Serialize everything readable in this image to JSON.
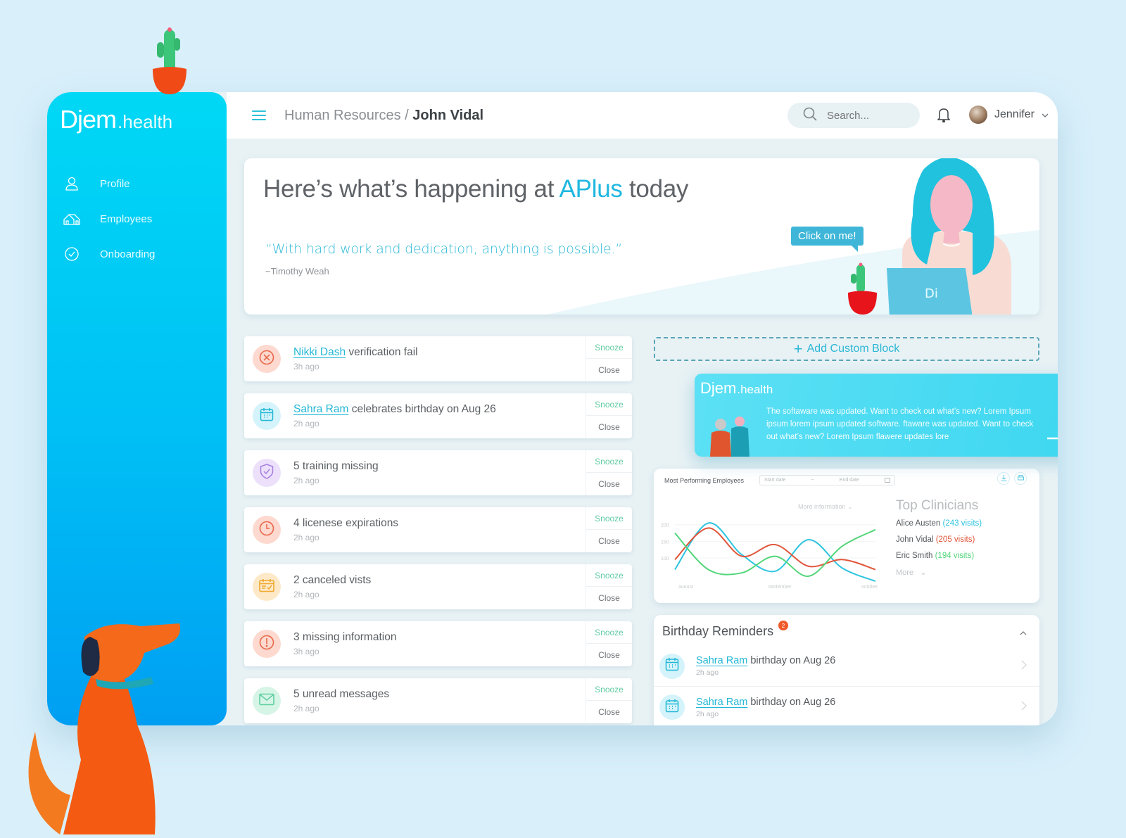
{
  "brand": {
    "name_main": "Djem",
    "name_suffix": ".health",
    "accent": "#1fb8e0",
    "sidebar_gradient": [
      "#00d8f5",
      "#009ef2"
    ]
  },
  "sidebar": {
    "items": [
      {
        "label": "Profile",
        "icon": "user-icon"
      },
      {
        "label": "Employees",
        "icon": "house-icon"
      },
      {
        "label": "Onboarding",
        "icon": "check-circle-icon"
      }
    ]
  },
  "topbar": {
    "breadcrumb_parent": "Human Resources",
    "breadcrumb_separator": " / ",
    "breadcrumb_current": "John Vidal",
    "search_placeholder": "Search...",
    "user_name": "Jennifer"
  },
  "hero": {
    "title_pre": "Here’s what’s happening at ",
    "title_accent": "APlus",
    "title_post": " today",
    "quote": "“With hard work and dedication, anything is possible.”",
    "quote_author": "~Timothy Weah",
    "bubble_label": "Click on me!"
  },
  "notifications": [
    {
      "link": "Nikki Dash",
      "text": " verification fail",
      "time": "3h ago",
      "icon": "x-circle-icon",
      "color": "#e8694a",
      "bg": "#fdd9cf"
    },
    {
      "link": "Sahra Ram",
      "text": " celebrates birthday on Aug 26",
      "time": "2h ago",
      "icon": "calendar-icon",
      "color": "#22b7d6",
      "bg": "#d4f3fb"
    },
    {
      "link": "",
      "text": "5 training missing",
      "time": "2h ago",
      "icon": "shield-check-icon",
      "color": "#a77fe0",
      "bg": "#ece0fb"
    },
    {
      "link": "",
      "text": "4 licenese expirations",
      "time": "2h ago",
      "icon": "clock-icon",
      "color": "#e8694a",
      "bg": "#fdd9cf"
    },
    {
      "link": "",
      "text": "2 canceled vists",
      "time": "2h ago",
      "icon": "calendar-check-icon",
      "color": "#f0a830",
      "bg": "#fde9c7"
    },
    {
      "link": "",
      "text": "3 missing information",
      "time": "3h ago",
      "icon": "alert-circle-icon",
      "color": "#e8694a",
      "bg": "#fdd9cf"
    },
    {
      "link": "",
      "text": "5 unread messages",
      "time": "2h ago",
      "icon": "mail-icon",
      "color": "#5fd0a0",
      "bg": "#d6f5e6"
    }
  ],
  "notification_actions": {
    "snooze": "Snooze",
    "close": "Close"
  },
  "add_block": {
    "plus": "+",
    "label": "Add Custom Block"
  },
  "update_card": {
    "text": "The softaware was updated. Want to check out what’s new? Lorem Ipsum ipsum lorem ipsum updated software. ftaware was updated. Want to check out what’s new? Lorem Ipsum flawere updates lore"
  },
  "performance": {
    "title": "Most Performing Employees",
    "start_date_placeholder": "Start date",
    "date_separator": "~",
    "end_date_placeholder": "End date",
    "more_information": "More information",
    "top_clinicians_title": "Top Clinicians",
    "clinicians": [
      {
        "name": "Alice Austen",
        "visits": "(243 visits)",
        "color": "#2ec4e0"
      },
      {
        "name": "John Vidal",
        "visits": "(205 visits)",
        "color": "#e0553a"
      },
      {
        "name": "Eric Smith",
        "visits": "(194 visits)",
        "color": "#52d67a"
      }
    ],
    "more_label": "More"
  },
  "chart_data": {
    "type": "line",
    "title": "Most Performing Employees",
    "x": [
      "august",
      "",
      "",
      "september",
      "",
      "",
      "october"
    ],
    "xticks": [
      "august",
      "september",
      "october"
    ],
    "yticks": [
      100,
      150,
      200
    ],
    "ylim": [
      30,
      210
    ],
    "series": [
      {
        "name": "Alice Austen",
        "color": "#2ec4e0",
        "values": [
          65,
          205,
          110,
          60,
          155,
          70,
          30
        ]
      },
      {
        "name": "John Vidal",
        "color": "#e0553a",
        "values": [
          95,
          190,
          105,
          140,
          75,
          95,
          65
        ]
      },
      {
        "name": "Eric Smith",
        "color": "#52d67a",
        "values": [
          175,
          65,
          55,
          105,
          45,
          135,
          185
        ]
      }
    ]
  },
  "birthdays": {
    "title": "Birthday Reminders",
    "badge": "2",
    "items": [
      {
        "link": "Sahra Ram",
        "text": " birthday on Aug 26",
        "time": "2h ago"
      },
      {
        "link": "Sahra Ram",
        "text": " birthday on Aug 26",
        "time": "2h ago"
      }
    ]
  }
}
